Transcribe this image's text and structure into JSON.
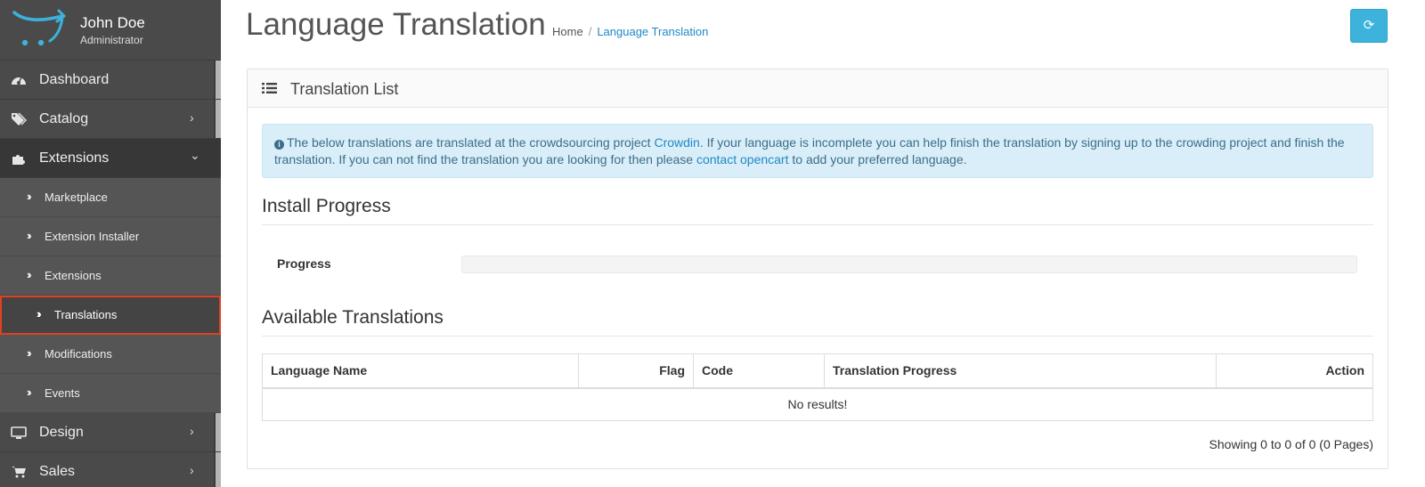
{
  "user": {
    "name": "John Doe",
    "role": "Administrator"
  },
  "sidebar": {
    "items": [
      {
        "label": "Dashboard",
        "icon": "dashboard-icon"
      },
      {
        "label": "Catalog",
        "icon": "tags-icon"
      },
      {
        "label": "Extensions",
        "icon": "puzzle-icon"
      },
      {
        "label": "Design",
        "icon": "monitor-icon"
      },
      {
        "label": "Sales",
        "icon": "cart-icon"
      }
    ],
    "sub_items": [
      {
        "label": "Marketplace"
      },
      {
        "label": "Extension Installer"
      },
      {
        "label": "Extensions"
      },
      {
        "label": "Translations"
      },
      {
        "label": "Modifications"
      },
      {
        "label": "Events"
      }
    ]
  },
  "page": {
    "title": "Language Translation",
    "breadcrumb": {
      "home": "Home",
      "separator": "/",
      "current": "Language Translation"
    }
  },
  "panel": {
    "title": "Translation List"
  },
  "alert": {
    "text_1": "The below translations are translated at the crowdsourcing project ",
    "link_1": "Crowdin",
    "text_2": ". If your language is incomplete you can help finish the translation by signing up to the crowding project and finish the translation. If you can not find the translation you are looking for then please ",
    "link_2": "contact opencart",
    "text_3": " to add your preferred language."
  },
  "install": {
    "title": "Install Progress",
    "progress_label": "Progress",
    "progress_value": 0
  },
  "available": {
    "title": "Available Translations",
    "columns": [
      "Language Name",
      "Flag",
      "Code",
      "Translation Progress",
      "Action"
    ],
    "empty": "No results!",
    "showing": "Showing 0 to 0 of 0 (0 Pages)"
  },
  "colors": {
    "accent": "#1e88c8",
    "button": "#3db2db",
    "active_border": "#e0411e",
    "sidebar": "#4a4a4a"
  }
}
